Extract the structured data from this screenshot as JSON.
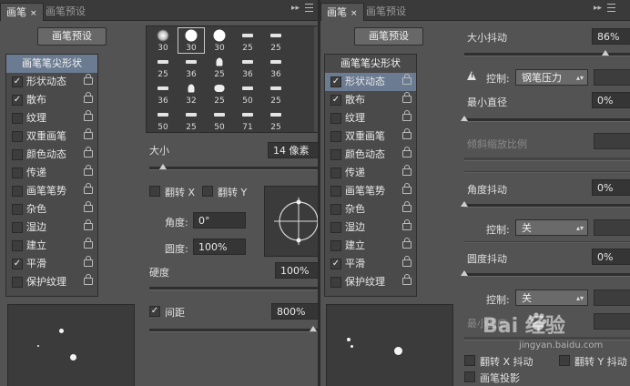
{
  "left_panel": {
    "tabs": [
      {
        "label": "画笔",
        "active": true
      },
      {
        "label": "画笔预设",
        "active": false
      }
    ],
    "preset_button": "画笔预设",
    "list_header": "画笔笔尖形状",
    "options": [
      {
        "label": "形状动态",
        "checked": true
      },
      {
        "label": "散布",
        "checked": true
      },
      {
        "label": "纹理",
        "checked": false
      },
      {
        "label": "双重画笔",
        "checked": false
      },
      {
        "label": "颜色动态",
        "checked": false
      },
      {
        "label": "传递",
        "checked": false
      },
      {
        "label": "画笔笔势",
        "checked": false
      },
      {
        "label": "杂色",
        "checked": false
      },
      {
        "label": "湿边",
        "checked": false
      },
      {
        "label": "建立",
        "checked": false
      },
      {
        "label": "平滑",
        "checked": true
      },
      {
        "label": "保护纹理",
        "checked": false
      }
    ],
    "brush_grid": {
      "rows": [
        [
          "30",
          "30",
          "30",
          "25",
          "25"
        ],
        [
          "25",
          "36",
          "25",
          "36",
          "36"
        ],
        [
          "36",
          "32",
          "25",
          "50",
          "25"
        ],
        [
          "50",
          "25",
          "50",
          "71",
          "25"
        ]
      ]
    },
    "size_label": "大小",
    "size_value": "14 像素",
    "size_level": 0.08,
    "flip_x": "翻转 X",
    "flip_y": "翻转 Y",
    "angle_label": "角度:",
    "angle_value": "0°",
    "roundness_label": "圆度:",
    "roundness_value": "100%",
    "hardness_label": "硬度",
    "hardness_value": "100%",
    "spacing_label": "间距",
    "spacing_checked": true,
    "spacing_value": "800%"
  },
  "right_panel": {
    "tabs": [
      {
        "label": "画笔",
        "active": true
      },
      {
        "label": "画笔预设",
        "active": false
      }
    ],
    "preset_button": "画笔预设",
    "list_header": "画笔笔尖形状",
    "options": [
      {
        "label": "形状动态",
        "checked": true,
        "selected": true
      },
      {
        "label": "散布",
        "checked": true,
        "selected": false
      },
      {
        "label": "纹理",
        "checked": false,
        "selected": false
      },
      {
        "label": "双重画笔",
        "checked": false,
        "selected": false
      },
      {
        "label": "颜色动态",
        "checked": false,
        "selected": false
      },
      {
        "label": "传递",
        "checked": false,
        "selected": false
      },
      {
        "label": "画笔笔势",
        "checked": false,
        "selected": false
      },
      {
        "label": "杂色",
        "checked": false,
        "selected": false
      },
      {
        "label": "湿边",
        "checked": false,
        "selected": false
      },
      {
        "label": "建立",
        "checked": false,
        "selected": false
      },
      {
        "label": "平滑",
        "checked": true,
        "selected": false
      },
      {
        "label": "保护纹理",
        "checked": false,
        "selected": false
      }
    ],
    "size_jitter_label": "大小抖动",
    "size_jitter_value": "86%",
    "control_label": "控制:",
    "control_value_pen": "钢笔压力",
    "min_diameter_label": "最小直径",
    "min_diameter_value": "0%",
    "tilt_scale_label": "倾斜缩放比例",
    "angle_jitter_label": "角度抖动",
    "angle_jitter_value": "0%",
    "control_value_off": "关",
    "roundness_jitter_label": "圆度抖动",
    "roundness_jitter_value": "0%",
    "min_roundness_label": "最小圆度",
    "flip_x_jitter": "翻转 X 抖动",
    "flip_y_jitter": "翻转 Y 抖动",
    "brush_projection": "画笔投影"
  },
  "watermark": {
    "brand": "Bai  经验",
    "url": "jingyan.baidu.com"
  }
}
